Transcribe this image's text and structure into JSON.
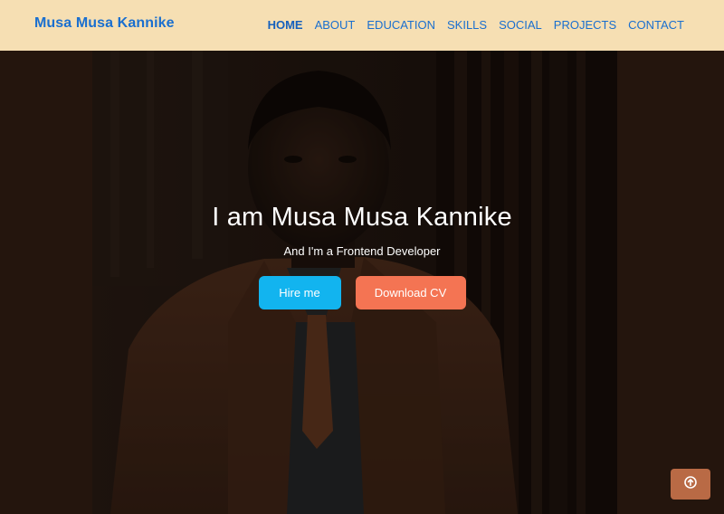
{
  "navbar": {
    "brand": "Musa Musa Kannike",
    "links": [
      "HOME",
      "ABOUT",
      "EDUCATION",
      "SKILLS",
      "SOCIAL",
      "PROJECTS",
      "CONTACT"
    ],
    "active": "HOME"
  },
  "hero": {
    "title": "I am Musa Musa Kannike",
    "subtitle": "And I'm a Frontend Developer",
    "hire_label": "Hire me",
    "cv_label": "Download CV"
  },
  "icons": {
    "scroll_top": "arrow-up-circle-icon"
  },
  "colors": {
    "navbar_bg": "#f6dfb3",
    "link": "#1a6fcf",
    "hire_button": "#12b4ef",
    "cv_button": "#f47453",
    "scroll_top_button": "#b96a45",
    "hero_bg": "#24150d"
  }
}
